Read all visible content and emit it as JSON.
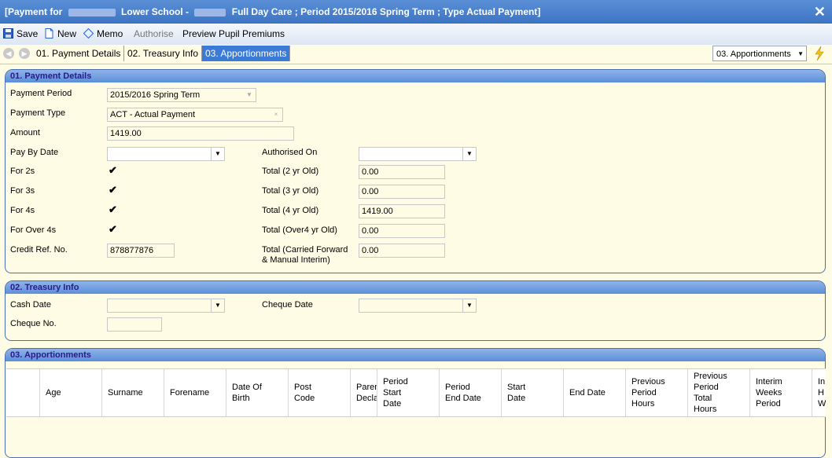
{
  "window": {
    "title_prefix": "[Payment for",
    "title_school": "Lower School -",
    "title_rest": "Full Day Care ; Period 2015/2016 Spring Term ; Type Actual Payment]"
  },
  "toolbar": {
    "save": "Save",
    "new": "New",
    "memo": "Memo",
    "authorise": "Authorise",
    "preview": "Preview Pupil Premiums"
  },
  "nav": {
    "tabs": [
      "01. Payment Details",
      "02. Treasury Info",
      "03. Apportionments"
    ],
    "select_value": "03. Apportionments"
  },
  "payment_details": {
    "header": "01. Payment Details",
    "payment_period_label": "Payment Period",
    "payment_period_value": "2015/2016 Spring Term",
    "payment_type_label": "Payment Type",
    "payment_type_value": "ACT - Actual Payment",
    "amount_label": "Amount",
    "amount_value": "1419.00",
    "pay_by_date_label": "Pay By Date",
    "authorised_on_label": "Authorised On",
    "for_2s_label": "For 2s",
    "for_3s_label": "For 3s",
    "for_4s_label": "For 4s",
    "for_over4s_label": "For Over 4s",
    "credit_ref_label": "Credit Ref. No.",
    "credit_ref_value": "878877876",
    "total_2_label": "Total (2 yr Old)",
    "total_2_value": "0.00",
    "total_3_label": "Total (3 yr Old)",
    "total_3_value": "0.00",
    "total_4_label": "Total (4 yr Old)",
    "total_4_value": "1419.00",
    "total_over4_label": "Total (Over4 yr Old)",
    "total_over4_value": "0.00",
    "total_cf_label_1": "Total (Carried Forward",
    "total_cf_label_2": "& Manual Interim)",
    "total_cf_value": "0.00"
  },
  "treasury": {
    "header": "02. Treasury Info",
    "cash_date_label": "Cash Date",
    "cheque_date_label": "Cheque Date",
    "cheque_no_label": "Cheque No."
  },
  "apportionments": {
    "header": "03. Apportionments",
    "columns": [
      "Age",
      "Surname",
      "Forename",
      "Date Of\nBirth",
      "Post\nCode",
      "Parent\nDeclar",
      "Period\nStart\nDate",
      "Period\nEnd Date",
      "Start\nDate",
      "End Date",
      "Previous\nPeriod\nHours",
      "Previous\nPeriod\nTotal\nHours",
      "Interim\nWeeks\nPeriod",
      "In\nH\nW"
    ]
  },
  "check_mark": "✔"
}
